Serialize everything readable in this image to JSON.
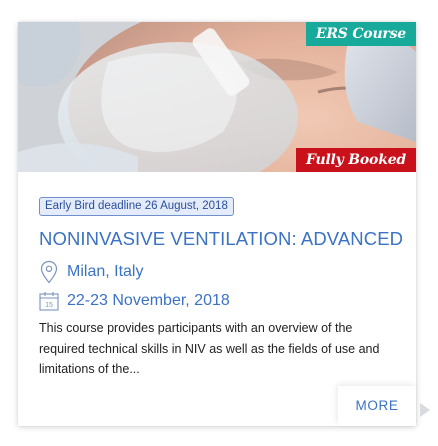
{
  "card": {
    "hero_image": "patient-with-noninvasive-ventilation-mask",
    "badges": {
      "course_type": "ERS Course",
      "status": "Fully Booked"
    },
    "deadline": "Early Bird deadline 26 August, 2018",
    "title": "NONINVASIVE VENTILATION: ADVANCED",
    "location": {
      "icon": "location-pin-icon",
      "text": "Milan, Italy"
    },
    "date": {
      "icon": "calendar-icon",
      "calendar_day": "15",
      "text": "22-23 November, 2018"
    },
    "description": "This course provides participants with an overview of the required technical skills in NIV as well as the fields of use and limitations of the...",
    "more_label": "MORE"
  },
  "colors": {
    "accent_blue": "#3b72c4",
    "teal_badge": "#17a99a",
    "red_badge": "#c8111b",
    "deadline_bg": "#e4ecfb"
  }
}
